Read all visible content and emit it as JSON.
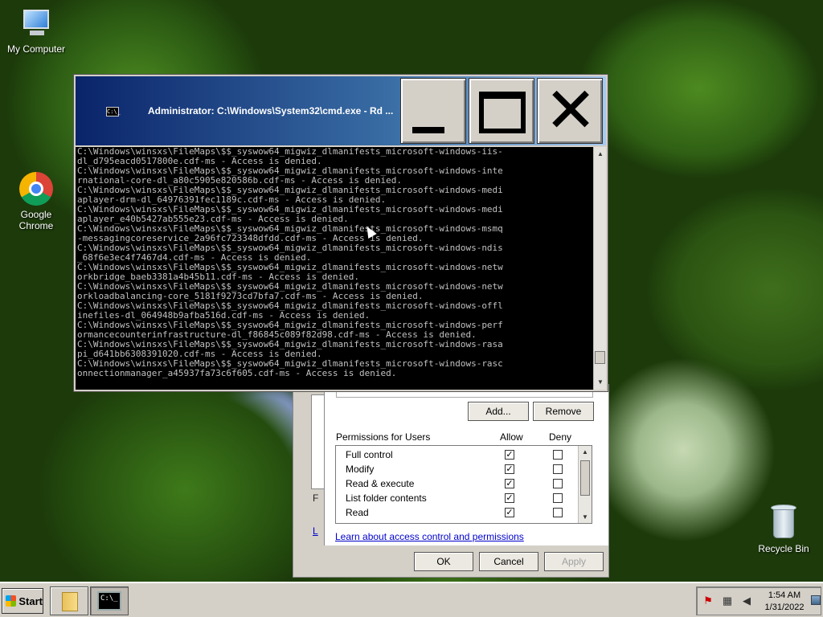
{
  "desktop": {
    "icons": [
      {
        "label": "My Computer"
      },
      {
        "label": "Google Chrome"
      },
      {
        "label": "Recycle Bin"
      }
    ]
  },
  "cmd_window": {
    "title": "Administrator: C:\\Windows\\System32\\cmd.exe - Rd ...",
    "title_icon": "C:\\_",
    "lines": [
      "C:\\Windows\\winsxs\\FileMaps\\$$_syswow64_migwiz_dlmanifests_microsoft-windows-iis-",
      "dl_d795eacd0517800e.cdf-ms - Access is denied.",
      "C:\\Windows\\winsxs\\FileMaps\\$$_syswow64_migwiz_dlmanifests_microsoft-windows-inte",
      "rnational-core-dl_a80c5905e820586b.cdf-ms - Access is denied.",
      "C:\\Windows\\winsxs\\FileMaps\\$$_syswow64_migwiz_dlmanifests_microsoft-windows-medi",
      "aplayer-drm-dl_64976391fec1189c.cdf-ms - Access is denied.",
      "C:\\Windows\\winsxs\\FileMaps\\$$_syswow64_migwiz_dlmanifests_microsoft-windows-medi",
      "aplayer_e40b5427ab555e23.cdf-ms - Access is denied.",
      "C:\\Windows\\winsxs\\FileMaps\\$$_syswow64_migwiz_dlmanifests_microsoft-windows-msmq",
      "-messagingcoreservice_2a96fc723348dfdd.cdf-ms - Access is denied.",
      "C:\\Windows\\winsxs\\FileMaps\\$$_syswow64_migwiz_dlmanifests_microsoft-windows-ndis",
      "_68f6e3ec4f7467d4.cdf-ms - Access is denied.",
      "C:\\Windows\\winsxs\\FileMaps\\$$_syswow64_migwiz_dlmanifests_microsoft-windows-netw",
      "orkbridge_baeb3381a4b45b11.cdf-ms - Access is denied.",
      "C:\\Windows\\winsxs\\FileMaps\\$$_syswow64_migwiz_dlmanifests_microsoft-windows-netw",
      "orkloadbalancing-core_5181f9273cd7bfa7.cdf-ms - Access is denied.",
      "C:\\Windows\\winsxs\\FileMaps\\$$_syswow64_migwiz_dlmanifests_microsoft-windows-offl",
      "inefiles-dl_064948b9afba516d.cdf-ms - Access is denied.",
      "C:\\Windows\\winsxs\\FileMaps\\$$_syswow64_migwiz_dlmanifests_microsoft-windows-perf",
      "ormancecounterinfrastructure-dl_f86845c089f82d98.cdf-ms - Access is denied.",
      "C:\\Windows\\winsxs\\FileMaps\\$$_syswow64_migwiz_dlmanifests_microsoft-windows-rasa",
      "pi_d641bb6308391020.cdf-ms - Access is denied.",
      "C:\\Windows\\winsxs\\FileMaps\\$$_syswow64_migwiz_dlmanifests_microsoft-windows-rasc",
      "onnectionmanager_a45937fa73c6f605.cdf-ms - Access is denied."
    ]
  },
  "properties_dialog": {
    "side_f": "F",
    "side_l": "L",
    "add_label": "Add...",
    "remove_label": "Remove",
    "permissions_header": "Permissions for Users",
    "allow_header": "Allow",
    "deny_header": "Deny",
    "permissions": [
      {
        "name": "Full control",
        "allow": true,
        "deny": false
      },
      {
        "name": "Modify",
        "allow": true,
        "deny": false
      },
      {
        "name": "Read & execute",
        "allow": true,
        "deny": false
      },
      {
        "name": "List folder contents",
        "allow": true,
        "deny": false
      },
      {
        "name": "Read",
        "allow": true,
        "deny": false
      }
    ],
    "learn_link": "Learn about access control and permissions",
    "ok_label": "OK",
    "cancel_label": "Cancel",
    "apply_label": "Apply"
  },
  "taskbar": {
    "start_label": "Start",
    "clock_time": "1:54 AM",
    "clock_date": "1/31/2022"
  }
}
